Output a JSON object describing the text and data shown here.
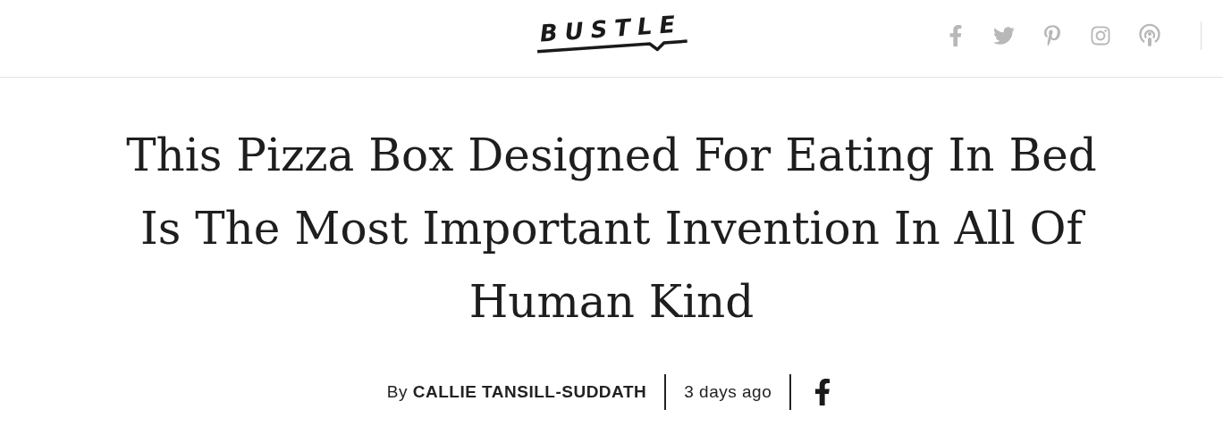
{
  "header": {
    "logo": "BUSTLE"
  },
  "article": {
    "headline": "This Pizza Box Designed For Eating In Bed Is The Most Important Invention In All Of Human Kind",
    "byline": "By **CALLIE TANSILL-SUDDATH**",
    "time": "3 days ago"
  }
}
